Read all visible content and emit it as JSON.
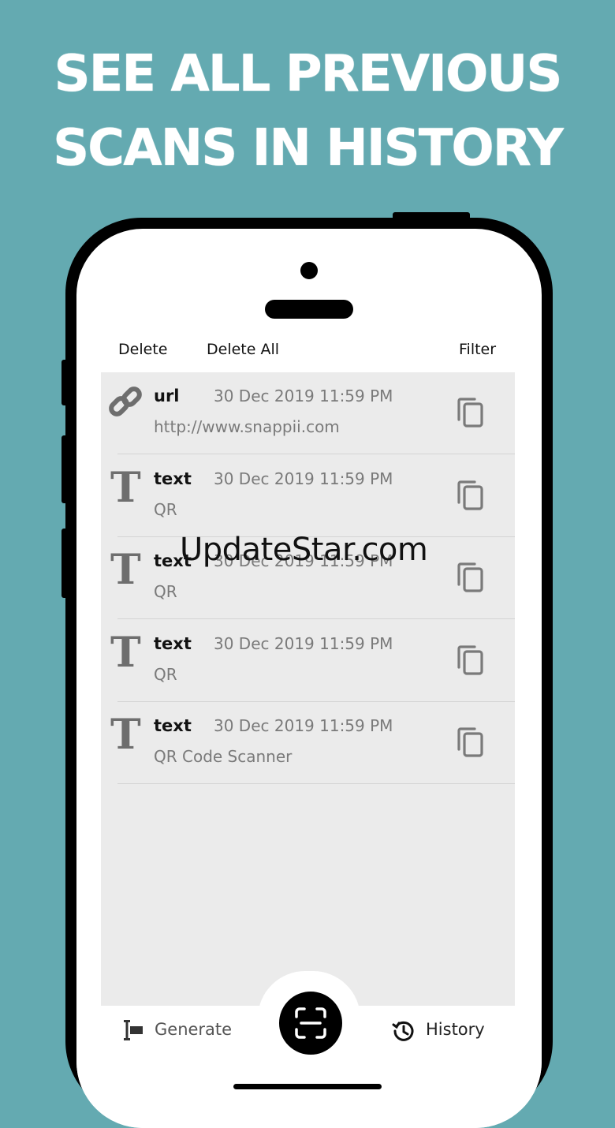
{
  "promo": {
    "headline_line1": "SEE ALL PREVIOUS",
    "headline_line2": "SCANS IN HISTORY"
  },
  "toolbar": {
    "delete_label": "Delete",
    "delete_all_label": "Delete All",
    "filter_label": "Filter"
  },
  "history": {
    "items": [
      {
        "type": "url",
        "timestamp": "30 Dec 2019 11:59 PM",
        "content": "http://www.snappii.com",
        "icon": "link-icon"
      },
      {
        "type": "text",
        "timestamp": "30 Dec 2019 11:59 PM",
        "content": "QR",
        "icon": "text-type-icon"
      },
      {
        "type": "text",
        "timestamp": "30 Dec 2019 11:59 PM",
        "content": "QR",
        "icon": "text-type-icon"
      },
      {
        "type": "text",
        "timestamp": "30 Dec 2019 11:59 PM",
        "content": "QR",
        "icon": "text-type-icon"
      },
      {
        "type": "text",
        "timestamp": "30 Dec 2019 11:59 PM",
        "content": "QR Code Scanner",
        "icon": "text-type-icon"
      }
    ],
    "text_glyph": "T"
  },
  "watermark": "UpdateStar.com",
  "tabbar": {
    "generate_label": "Generate",
    "history_label": "History",
    "scan_icon": "scan-icon"
  },
  "colors": {
    "background": "#64aab1",
    "list_background": "#ebebeb",
    "icon_gray": "#6e6e6e"
  }
}
